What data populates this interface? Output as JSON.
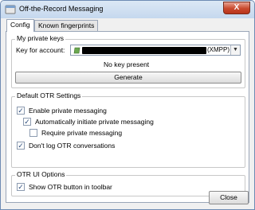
{
  "window": {
    "title": "Off-the-Record Messaging",
    "close_glyph": "X"
  },
  "tabs": [
    {
      "label": "Config",
      "active": true
    },
    {
      "label": "Known fingerprints",
      "active": false
    }
  ],
  "private_keys": {
    "group_title": "My private keys",
    "account_label": "Key for account:",
    "account_suffix": "(XMPP)",
    "status": "No key present",
    "generate_label": "Generate"
  },
  "default_settings": {
    "group_title": "Default OTR Settings",
    "options": [
      {
        "label": "Enable private messaging",
        "checked": true
      },
      {
        "label": "Automatically initiate private messaging",
        "checked": true
      },
      {
        "label": "Require private messaging",
        "checked": false
      },
      {
        "label": "Don't log OTR conversations",
        "checked": true
      }
    ]
  },
  "ui_options": {
    "group_title": "OTR UI Options",
    "options": [
      {
        "label": "Show OTR button in toolbar",
        "checked": true
      }
    ]
  },
  "footer": {
    "close_label": "Close"
  },
  "icons": {
    "app": "otr-window-icon",
    "account": "xmpp-account-icon",
    "dropdown": "chevron-down-icon"
  }
}
